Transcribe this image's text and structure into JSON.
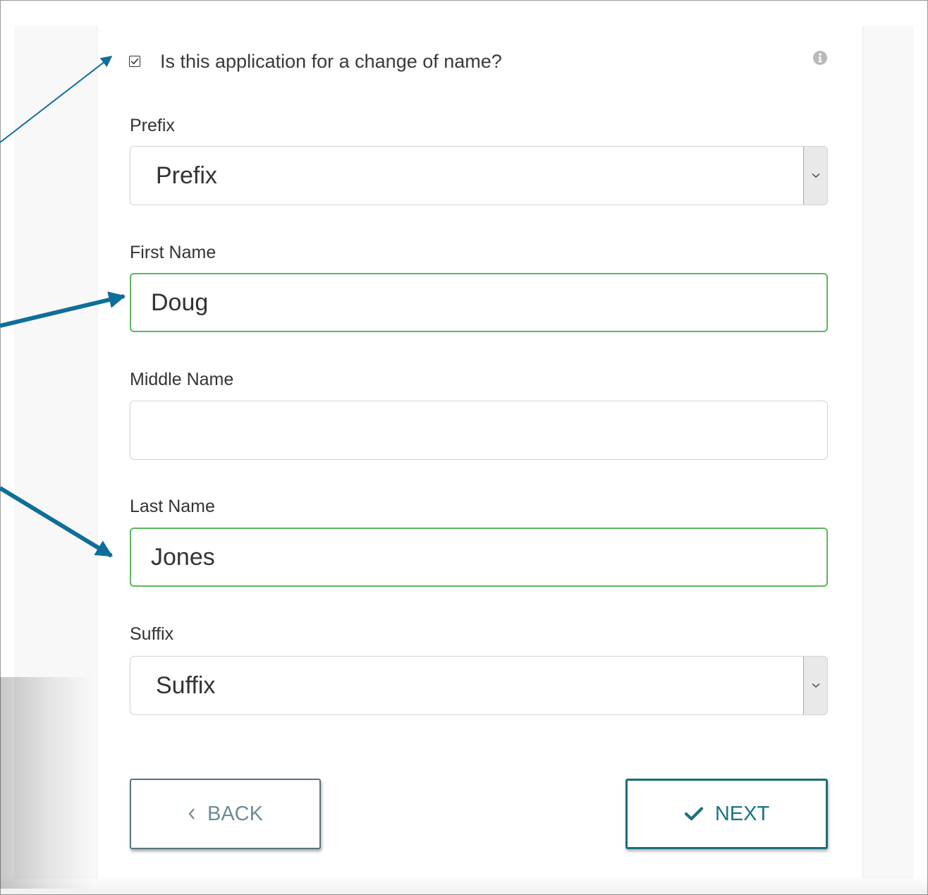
{
  "checkbox": {
    "label": "Is this application for a change of name?",
    "checked": true
  },
  "info_icon": "info-circle-icon",
  "fields": {
    "prefix": {
      "label": "Prefix",
      "value": "Prefix"
    },
    "first_name": {
      "label": "First Name",
      "value": "Doug"
    },
    "middle_name": {
      "label": "Middle Name",
      "value": ""
    },
    "last_name": {
      "label": "Last Name",
      "value": "Jones"
    },
    "suffix": {
      "label": "Suffix",
      "value": "Suffix"
    }
  },
  "buttons": {
    "back": "BACK",
    "next": "NEXT"
  },
  "colors": {
    "valid_border": "#5cb85c",
    "next_accent": "#1a7585",
    "back_text": "#6e8b98",
    "annotation_arrow": "#0e6e9a"
  }
}
